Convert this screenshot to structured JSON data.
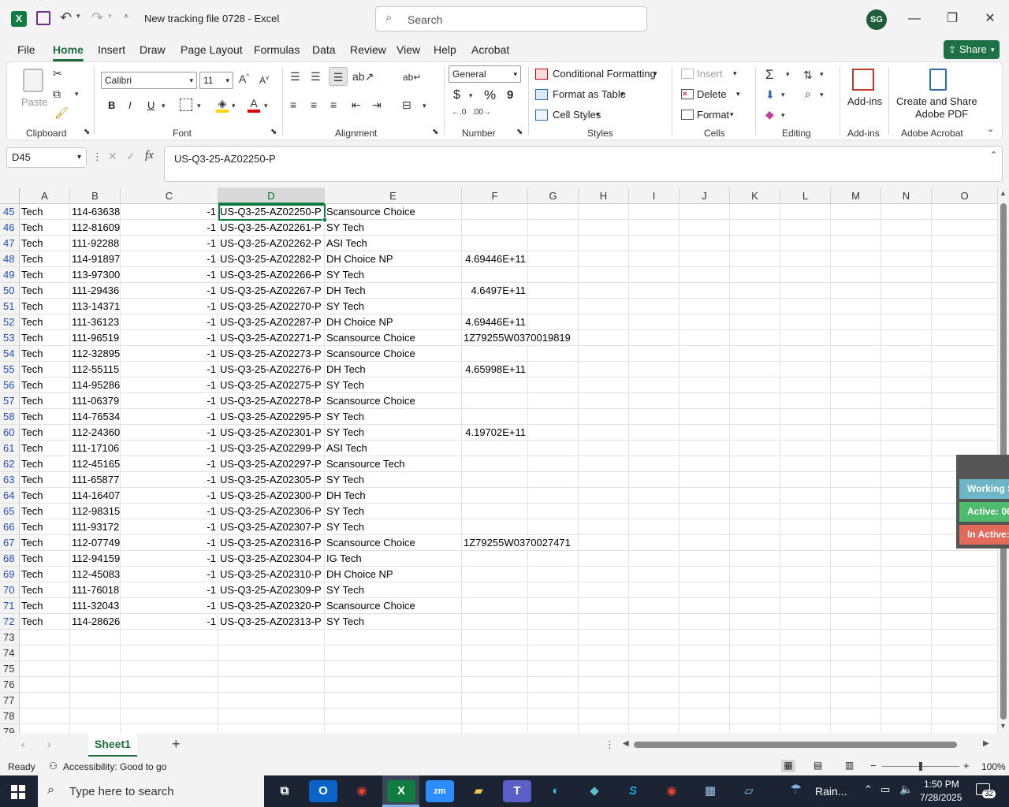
{
  "app": {
    "title": "New tracking file 0728  -  Excel",
    "search_placeholder": "Search",
    "avatar_initials": "SG"
  },
  "menu": [
    "File",
    "Home",
    "Insert",
    "Draw",
    "Page Layout",
    "Formulas",
    "Data",
    "Review",
    "View",
    "Help",
    "Acrobat"
  ],
  "share_label": "Share",
  "ribbon": {
    "clipboard": {
      "paste": "Paste",
      "label": "Clipboard"
    },
    "font": {
      "name": "Calibri",
      "size": "11",
      "label": "Font",
      "bold": "B",
      "italic": "I",
      "underline": "U"
    },
    "alignment": {
      "label": "Alignment"
    },
    "number": {
      "format": "General",
      "currency": "$",
      "percent": "%",
      "comma": "9",
      "label": "Number"
    },
    "styles": {
      "conditional": "Conditional Formatting",
      "table": "Format as Table",
      "cell_styles": "Cell Styles",
      "label": "Styles"
    },
    "cells": {
      "insert": "Insert",
      "delete": "Delete",
      "format": "Format",
      "label": "Cells"
    },
    "editing": {
      "label": "Editing"
    },
    "addins": {
      "button": "Add-ins",
      "label": "Add-ins"
    },
    "acrobat": {
      "button_line1": "Create and Share",
      "button_line2": "Adobe PDF",
      "label": "Adobe Acrobat"
    }
  },
  "formula_bar": {
    "name_box": "D45",
    "fx": "fx",
    "value": "US-Q3-25-AZ02250-P"
  },
  "columns": [
    "A",
    "B",
    "C",
    "D",
    "E",
    "F",
    "G",
    "H",
    "I",
    "J",
    "K",
    "L",
    "M",
    "N",
    "O"
  ],
  "rows": [
    {
      "n": "45",
      "a": "Tech",
      "b": "114-63638",
      "c": "-1",
      "d": "US-Q3-25-AZ02250-P",
      "e": "Scansource Choice",
      "f": ""
    },
    {
      "n": "46",
      "a": "Tech",
      "b": "112-81609",
      "c": "-1",
      "d": "US-Q3-25-AZ02261-P",
      "e": "SY Tech",
      "f": ""
    },
    {
      "n": "47",
      "a": "Tech",
      "b": "111-92288",
      "c": "-1",
      "d": "US-Q3-25-AZ02262-P",
      "e": "ASI Tech",
      "f": ""
    },
    {
      "n": "48",
      "a": "Tech",
      "b": "114-91897",
      "c": "-1",
      "d": "US-Q3-25-AZ02282-P",
      "e": "DH Choice NP",
      "f": "4.69446E+11"
    },
    {
      "n": "49",
      "a": "Tech",
      "b": "113-97300",
      "c": "-1",
      "d": "US-Q3-25-AZ02266-P",
      "e": "SY Tech",
      "f": ""
    },
    {
      "n": "50",
      "a": "Tech",
      "b": "111-29436",
      "c": "-1",
      "d": "US-Q3-25-AZ02267-P",
      "e": "DH Tech",
      "f": "4.6497E+11"
    },
    {
      "n": "51",
      "a": "Tech",
      "b": "113-14371",
      "c": "-1",
      "d": "US-Q3-25-AZ02270-P",
      "e": "SY Tech",
      "f": ""
    },
    {
      "n": "52",
      "a": "Tech",
      "b": "111-36123",
      "c": "-1",
      "d": "US-Q3-25-AZ02287-P",
      "e": "DH Choice NP",
      "f": "4.69446E+11"
    },
    {
      "n": "53",
      "a": "Tech",
      "b": "111-96519",
      "c": "-1",
      "d": "US-Q3-25-AZ02271-P",
      "e": "Scansource Choice",
      "f": "1Z79255W0370019819"
    },
    {
      "n": "54",
      "a": "Tech",
      "b": "112-32895",
      "c": "-1",
      "d": "US-Q3-25-AZ02273-P",
      "e": "Scansource Choice",
      "f": ""
    },
    {
      "n": "55",
      "a": "Tech",
      "b": "112-55115",
      "c": "-1",
      "d": "US-Q3-25-AZ02276-P",
      "e": "DH Tech",
      "f": "4.65998E+11"
    },
    {
      "n": "56",
      "a": "Tech",
      "b": "114-95286",
      "c": "-1",
      "d": "US-Q3-25-AZ02275-P",
      "e": "SY Tech",
      "f": ""
    },
    {
      "n": "57",
      "a": "Tech",
      "b": "111-06379",
      "c": "-1",
      "d": "US-Q3-25-AZ02278-P",
      "e": "Scansource Choice",
      "f": ""
    },
    {
      "n": "58",
      "a": "Tech",
      "b": "114-76534",
      "c": "-1",
      "d": "US-Q3-25-AZ02295-P",
      "e": "SY Tech",
      "f": ""
    },
    {
      "n": "60",
      "a": "Tech",
      "b": "112-24360",
      "c": "-1",
      "d": "US-Q3-25-AZ02301-P",
      "e": "SY Tech",
      "f": "4.19702E+11"
    },
    {
      "n": "61",
      "a": "Tech",
      "b": "111-17106",
      "c": "-1",
      "d": "US-Q3-25-AZ02299-P",
      "e": "ASI Tech",
      "f": ""
    },
    {
      "n": "62",
      "a": "Tech",
      "b": "112-45165",
      "c": "-1",
      "d": "US-Q3-25-AZ02297-P",
      "e": "Scansource Tech",
      "f": ""
    },
    {
      "n": "63",
      "a": "Tech",
      "b": "111-65877",
      "c": "-1",
      "d": "US-Q3-25-AZ02305-P",
      "e": "SY Tech",
      "f": ""
    },
    {
      "n": "64",
      "a": "Tech",
      "b": "114-16407",
      "c": "-1",
      "d": "US-Q3-25-AZ02300-P",
      "e": "DH Tech",
      "f": ""
    },
    {
      "n": "65",
      "a": "Tech",
      "b": "112-98315",
      "c": "-1",
      "d": "US-Q3-25-AZ02306-P",
      "e": "SY Tech",
      "f": ""
    },
    {
      "n": "66",
      "a": "Tech",
      "b": "111-93172",
      "c": "-1",
      "d": "US-Q3-25-AZ02307-P",
      "e": "SY Tech",
      "f": ""
    },
    {
      "n": "67",
      "a": "Tech",
      "b": "112-07749",
      "c": "-1",
      "d": "US-Q3-25-AZ02316-P",
      "e": "Scansource Choice",
      "f": "1Z79255W0370027471"
    },
    {
      "n": "68",
      "a": "Tech",
      "b": "112-94159",
      "c": "-1",
      "d": "US-Q3-25-AZ02304-P",
      "e": "IG Tech",
      "f": ""
    },
    {
      "n": "69",
      "a": "Tech",
      "b": "112-45083",
      "c": "-1",
      "d": "US-Q3-25-AZ02310-P",
      "e": "DH Choice NP",
      "f": ""
    },
    {
      "n": "70",
      "a": "Tech",
      "b": "111-76018",
      "c": "-1",
      "d": "US-Q3-25-AZ02309-P",
      "e": "SY Tech",
      "f": ""
    },
    {
      "n": "71",
      "a": "Tech",
      "b": "111-32043",
      "c": "-1",
      "d": "US-Q3-25-AZ02320-P",
      "e": "Scansource Choice",
      "f": ""
    },
    {
      "n": "72",
      "a": "Tech",
      "b": "114-28626",
      "c": "-1",
      "d": "US-Q3-25-AZ02313-P",
      "e": "SY Tech",
      "f": ""
    },
    {
      "n": "73"
    },
    {
      "n": "74"
    },
    {
      "n": "75"
    },
    {
      "n": "76"
    },
    {
      "n": "77"
    },
    {
      "n": "78"
    },
    {
      "n": "79"
    }
  ],
  "sheet_tab": "Sheet1",
  "status": {
    "ready": "Ready",
    "accessibility": "Accessibility: Good to go",
    "zoom": "100%"
  },
  "widget": {
    "working": "Working S",
    "active": "Active: 06",
    "inactive": "In Active:"
  },
  "taskbar": {
    "search_placeholder": "Type here to search",
    "weather": "Rain...",
    "time": "1:50 PM",
    "date": "7/28/2025",
    "notifications": "32"
  },
  "colors": {
    "excel_green": "#107c41",
    "share_green": "#1e7145",
    "row_number_blue": "#1f4eb3"
  }
}
